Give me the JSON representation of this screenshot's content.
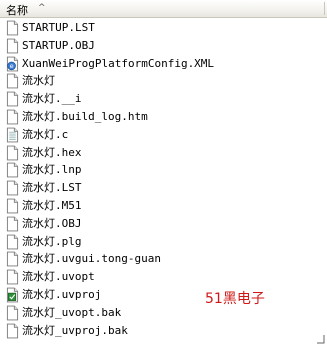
{
  "header": {
    "name_label": "名称",
    "sort_icon": "chevron-up-icon"
  },
  "files": [
    {
      "name": "STARTUP.LST",
      "icon": "document-icon"
    },
    {
      "name": "STARTUP.OBJ",
      "icon": "document-icon"
    },
    {
      "name": "XuanWeiProgPlatformConfig.XML",
      "icon": "xml-file-icon"
    },
    {
      "name": "流水灯",
      "icon": "document-icon"
    },
    {
      "name": "流水灯.__i",
      "icon": "document-icon"
    },
    {
      "name": "流水灯.build_log.htm",
      "icon": "document-icon"
    },
    {
      "name": "流水灯.c",
      "icon": "text-file-icon"
    },
    {
      "name": "流水灯.hex",
      "icon": "document-icon"
    },
    {
      "name": "流水灯.lnp",
      "icon": "document-icon"
    },
    {
      "name": "流水灯.LST",
      "icon": "document-icon"
    },
    {
      "name": "流水灯.M51",
      "icon": "document-icon"
    },
    {
      "name": "流水灯.OBJ",
      "icon": "document-icon"
    },
    {
      "name": "流水灯.plg",
      "icon": "document-icon"
    },
    {
      "name": "流水灯.uvgui.tong-guan",
      "icon": "document-icon"
    },
    {
      "name": "流水灯.uvopt",
      "icon": "document-icon"
    },
    {
      "name": "流水灯.uvproj",
      "icon": "keil-project-icon"
    },
    {
      "name": "流水灯_uvopt.bak",
      "icon": "document-icon"
    },
    {
      "name": "流水灯_uvproj.bak",
      "icon": "document-icon"
    }
  ],
  "watermark": "51黑电子",
  "colors": {
    "watermark": "#d01818",
    "header_bg": "#f3f2ee"
  }
}
